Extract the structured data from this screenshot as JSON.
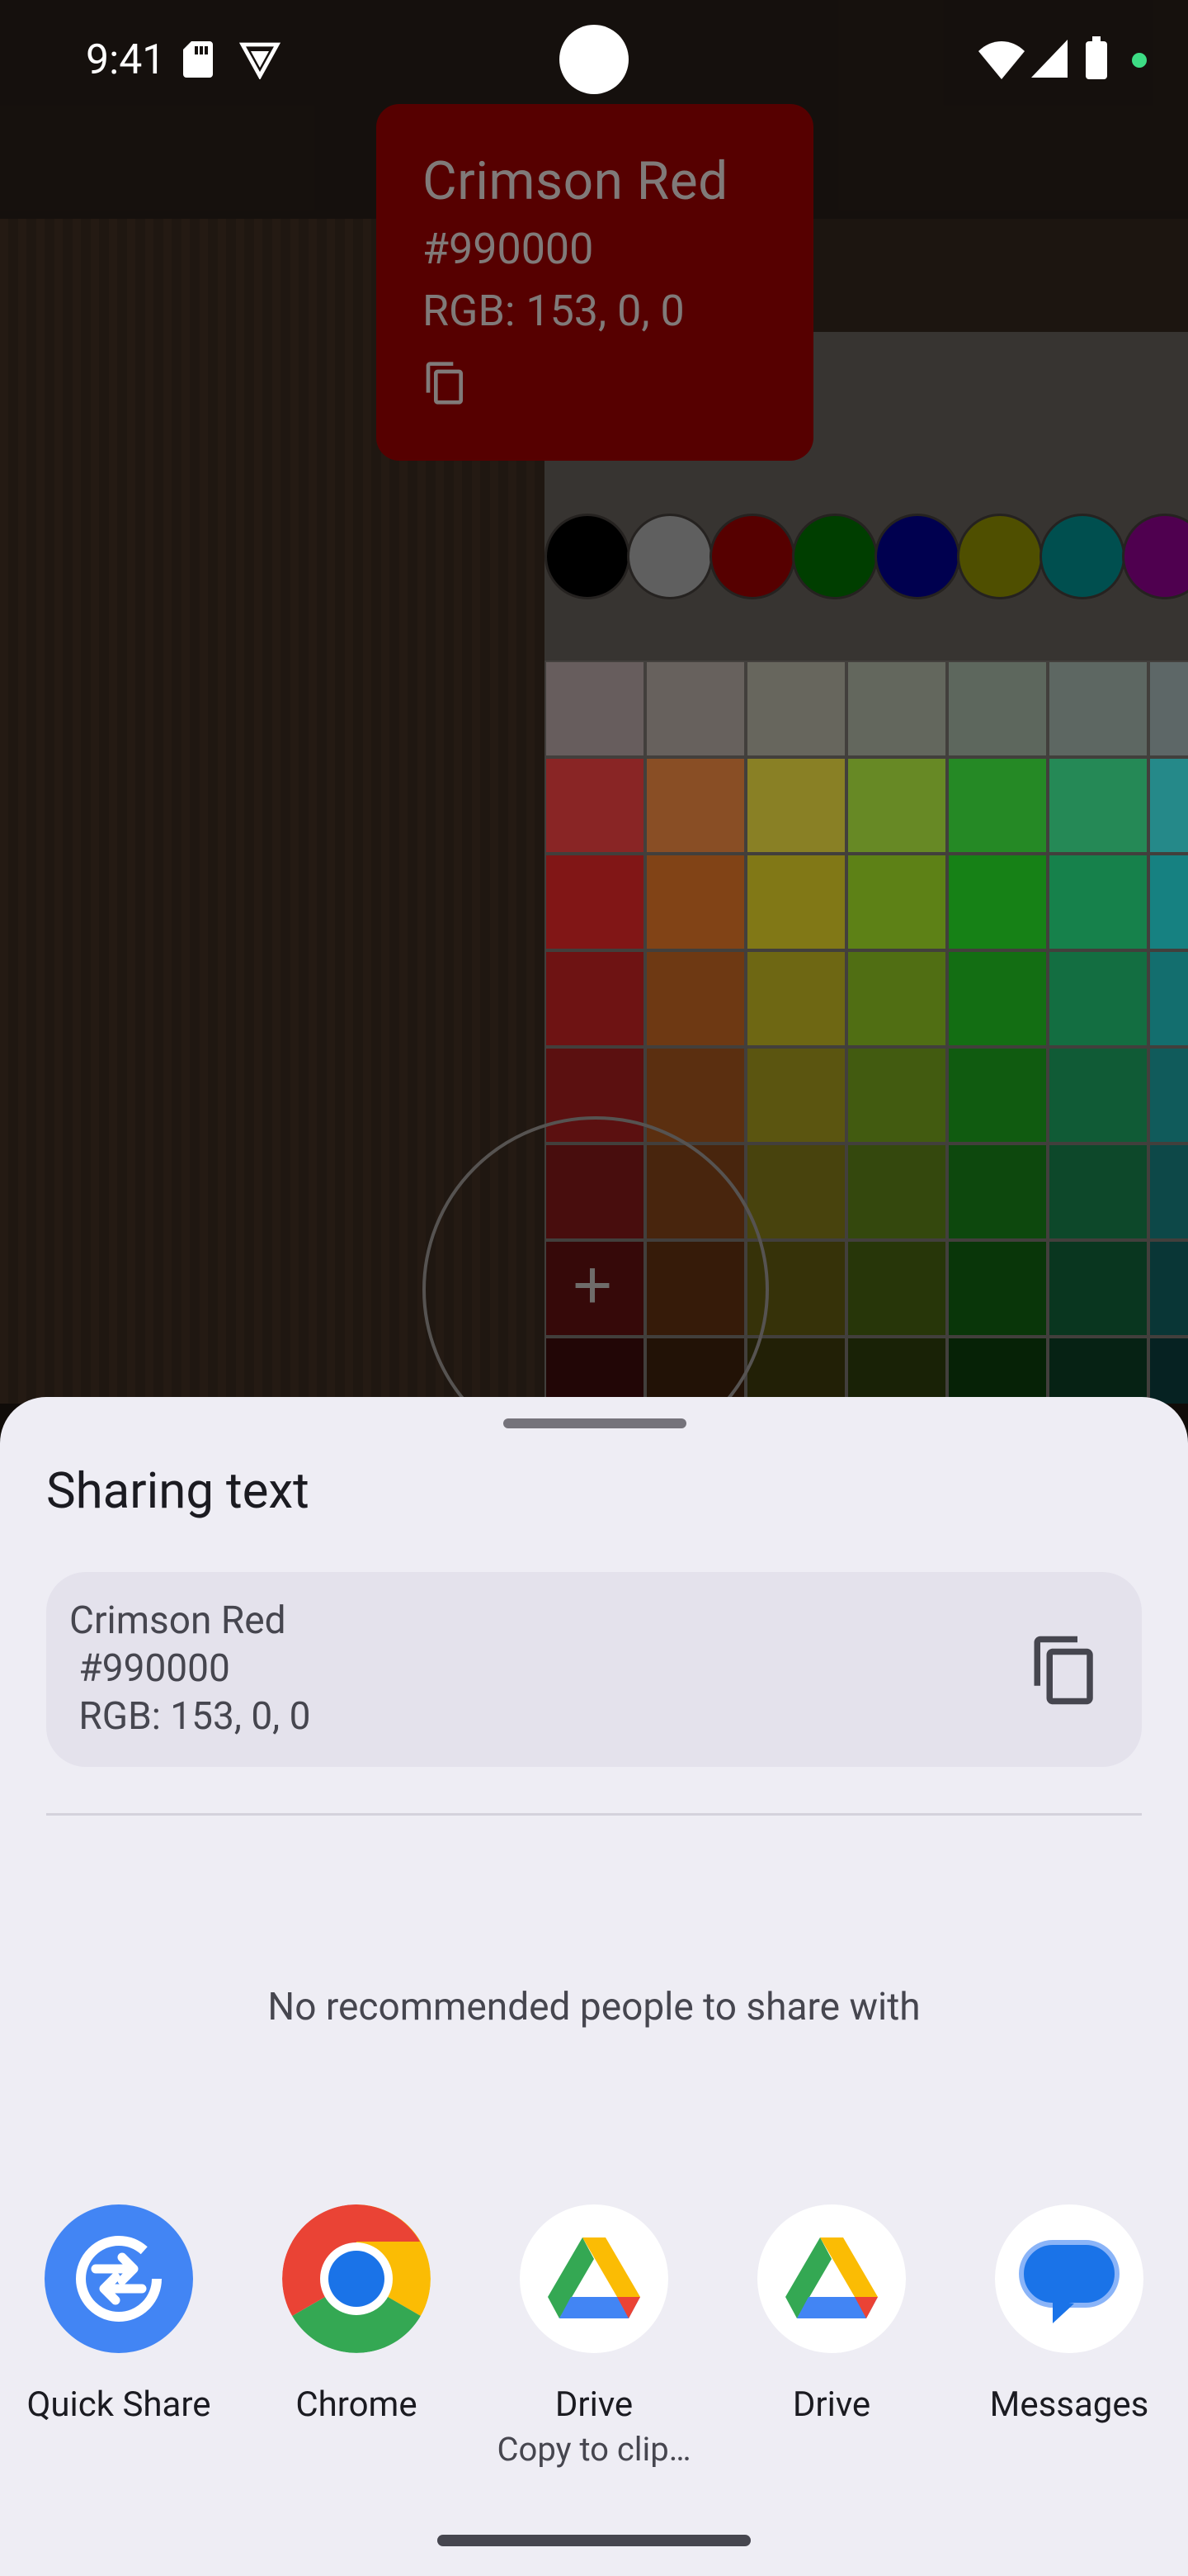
{
  "status_bar": {
    "time": "9:41"
  },
  "background_app": {
    "color_card": {
      "name": "Crimson Red",
      "hex": "#990000",
      "rgb": "RGB: 153, 0, 0"
    },
    "swatches": [
      "#000000",
      "#9a9a9a",
      "#8b0000",
      "#006400",
      "#000080",
      "#808000",
      "#008080",
      "#800080"
    ]
  },
  "share_sheet": {
    "title": "Sharing text",
    "preview_text": "Crimson Red\n #990000\n RGB: 153, 0, 0",
    "empty_message": "No recommended people to share with",
    "apps": [
      {
        "label": "Quick Share",
        "sub": "",
        "icon": "quick-share-icon"
      },
      {
        "label": "Chrome",
        "sub": "",
        "icon": "chrome-icon"
      },
      {
        "label": "Drive",
        "sub": "Copy to clip…",
        "icon": "drive-icon"
      },
      {
        "label": "Drive",
        "sub": "",
        "icon": "drive-icon"
      },
      {
        "label": "Messages",
        "sub": "",
        "icon": "messages-icon"
      }
    ]
  },
  "colors": {
    "sheet_bg": "#eeedf4",
    "preview_bg": "#e4e2ec",
    "quick_share_blue": "#4285f4",
    "chrome_red": "#ea4335",
    "chrome_yellow": "#fbbc04",
    "chrome_green": "#34a853"
  }
}
